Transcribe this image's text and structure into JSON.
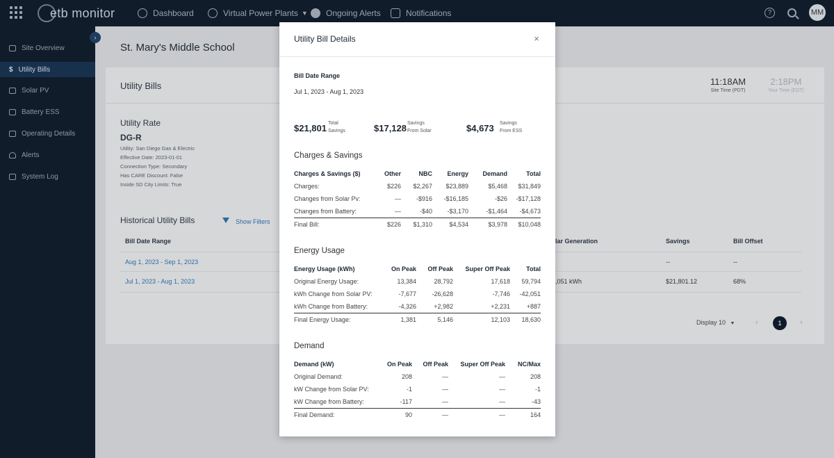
{
  "topbar": {
    "logo": "etb monitor",
    "nav": [
      {
        "label": "Dashboard"
      },
      {
        "label": "Virtual Power Plants"
      },
      {
        "label": "Ongoing Alerts"
      },
      {
        "label": "Notifications"
      }
    ],
    "help": "?",
    "avatar": "MM"
  },
  "sidebar": {
    "collapse": "›",
    "items": [
      {
        "label": "Site Overview"
      },
      {
        "label": "Utility Bills"
      },
      {
        "label": "Solar PV"
      },
      {
        "label": "Battery ESS"
      },
      {
        "label": "Operating Details"
      },
      {
        "label": "Alerts"
      },
      {
        "label": "System Log"
      }
    ]
  },
  "page": {
    "site_title": "St. Mary's Middle School",
    "card_title": "Utility Bills",
    "site_time": "11:18AM",
    "site_time_label": "Site Time (PDT)",
    "your_time": "2:18PM",
    "your_time_label": "Your Time (EDT)",
    "rate_title": "Utility Rate",
    "rate_code": "DG-R",
    "rate_lines": [
      "Utility: San Diego Gas & Electric",
      "Effective Date: 2023-01-01",
      "Connection Type: Secondary",
      "Has CARE Discount: False",
      "Inside SD City Limits: True"
    ],
    "hist_title": "Historical Utility Bills",
    "show_filters": "Show Filters",
    "columns": {
      "bill_date_range": "Bill Date Range",
      "solar_generation": "lar Generation",
      "savings": "Savings",
      "bill_offset": "Bill Offset"
    },
    "rows": [
      {
        "range": "Aug 1, 2023 - Sep 1, 2023",
        "solar": "",
        "savings": "--",
        "offset": "--"
      },
      {
        "range": "Jul 1, 2023 - Aug 1, 2023",
        "solar": ",051 kWh",
        "savings": "$21,801.12",
        "offset": "68%"
      }
    ],
    "display": "Display 10",
    "page_prev": "‹",
    "page_current": "1",
    "page_next": "›"
  },
  "modal": {
    "title": "Utility Bill Details",
    "close": "×",
    "date_range_label": "Bill Date Range",
    "date_range": "Jul 1, 2023 - Aug 1, 2023",
    "kpis": [
      {
        "value": "$21,801",
        "label1": "Total",
        "label2": "Savings"
      },
      {
        "value": "$17,128",
        "label1": "Savings",
        "label2": "From Solar"
      },
      {
        "value": "$4,673",
        "label1": "Savings",
        "label2": "From ESS"
      }
    ],
    "charges": {
      "title": "Charges & Savings",
      "headers": [
        "Charges & Savings ($)",
        "Other",
        "NBC",
        "Energy",
        "Demand",
        "Total"
      ],
      "rows": [
        [
          "Charges:",
          "$226",
          "$2,267",
          "$23,889",
          "$5,468",
          "$31,849"
        ],
        [
          "Changes from Solar Pv:",
          "—",
          "-$916",
          "-$16,185",
          "-$26",
          "-$17,128"
        ],
        [
          "Changes from Battery:",
          "—",
          "-$40",
          "-$3,170",
          "-$1,464",
          "-$4,673"
        ],
        [
          "Final Bill:",
          "$226",
          "$1,310",
          "$4,534",
          "$3,978",
          "$10,048"
        ]
      ]
    },
    "energy": {
      "title": "Energy Usage",
      "headers": [
        "Energy Usage (kWh)",
        "On Peak",
        "Off Peak",
        "Super Off Peak",
        "Total"
      ],
      "rows": [
        [
          "Original Energy Usage:",
          "13,384",
          "28,792",
          "17,618",
          "59,794"
        ],
        [
          "kWh Change from Solar PV:",
          "-7,677",
          "-26,628",
          "-7,746",
          "-42,051"
        ],
        [
          "kWh Change from Battery:",
          "-4,326",
          "+2,982",
          "+2,231",
          "+887"
        ],
        [
          "Final Energy Usage:",
          "1,381",
          "5,146",
          "12,103",
          "18,630"
        ]
      ]
    },
    "demand": {
      "title": "Demand",
      "headers": [
        "Demand (kW)",
        "On Peak",
        "Off Peak",
        "Super Off Peak",
        "NC/Max"
      ],
      "rows": [
        [
          "Original Demand:",
          "208",
          "—",
          "—",
          "208"
        ],
        [
          "kW Change from Solar PV:",
          "-1",
          "—",
          "—",
          "-1"
        ],
        [
          "kW Change from Battery:",
          "-117",
          "—",
          "—",
          "-43"
        ],
        [
          "Final Demand:",
          "90",
          "—",
          "—",
          "164"
        ]
      ]
    }
  }
}
